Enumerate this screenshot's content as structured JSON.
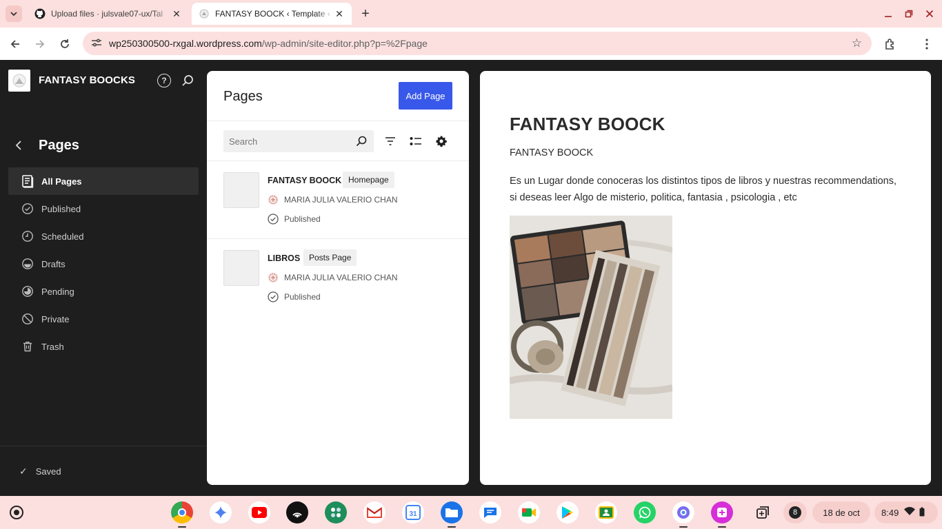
{
  "browser": {
    "tabs": [
      {
        "title": "Upload files · julsvale07-ux/Tal",
        "favicon": "github-icon",
        "active": false
      },
      {
        "title": "FANTASY BOOCK ‹ Template ‹ F",
        "favicon": "wordpress-site-icon",
        "active": true
      }
    ],
    "url_host": "wp250300500-rxgal.wordpress.com",
    "url_path": "/wp-admin/site-editor.php?p=%2Fpage"
  },
  "sidebar": {
    "site_name": "FANTASY BOOCKS",
    "heading": "Pages",
    "items": [
      {
        "label": "All Pages",
        "icon": "pages-icon",
        "active": true
      },
      {
        "label": "Published",
        "icon": "published-icon",
        "active": false
      },
      {
        "label": "Scheduled",
        "icon": "scheduled-icon",
        "active": false
      },
      {
        "label": "Drafts",
        "icon": "drafts-icon",
        "active": false
      },
      {
        "label": "Pending",
        "icon": "pending-icon",
        "active": false
      },
      {
        "label": "Private",
        "icon": "private-icon",
        "active": false
      },
      {
        "label": "Trash",
        "icon": "trash-icon",
        "active": false
      }
    ],
    "saved_label": "Saved"
  },
  "pages_panel": {
    "title": "Pages",
    "add_button": "Add Page",
    "search_placeholder": "Search",
    "rows": [
      {
        "title": "FANTASY BOOCK",
        "badge": "Homepage",
        "author": "MARIA JULIA VALERIO CHAN",
        "status": "Published"
      },
      {
        "title": "LIBROS",
        "badge": "Posts Page",
        "author": "MARIA JULIA VALERIO CHAN",
        "status": "Published"
      }
    ]
  },
  "preview": {
    "heading": "FANTASY BOOCK",
    "subtitle": "FANTASY BOOCK",
    "paragraph": "Es un Lugar donde conoceras los distintos tipos de libros y nuestras recommendations, si deseas leer Algo de misterio, politica, fantasia , psicologia , etc"
  },
  "taskbar": {
    "apps": [
      "chrome-icon",
      "gemini-icon",
      "youtube-icon",
      "podcast-icon",
      "apps-icon",
      "gmail-icon",
      "calendar-icon",
      "files-icon",
      "messages-icon",
      "meet-icon",
      "play-store-icon",
      "classroom-icon",
      "whatsapp-icon",
      "photos-icon",
      "canvas-icon"
    ],
    "calendar_day": "31",
    "notification_count": "8",
    "date": "18 de oct",
    "time": "8:49"
  },
  "colors": {
    "accent": "#3858e9",
    "chrome_tint": "#fbe0df",
    "admin_dark": "#1e1e1e"
  }
}
